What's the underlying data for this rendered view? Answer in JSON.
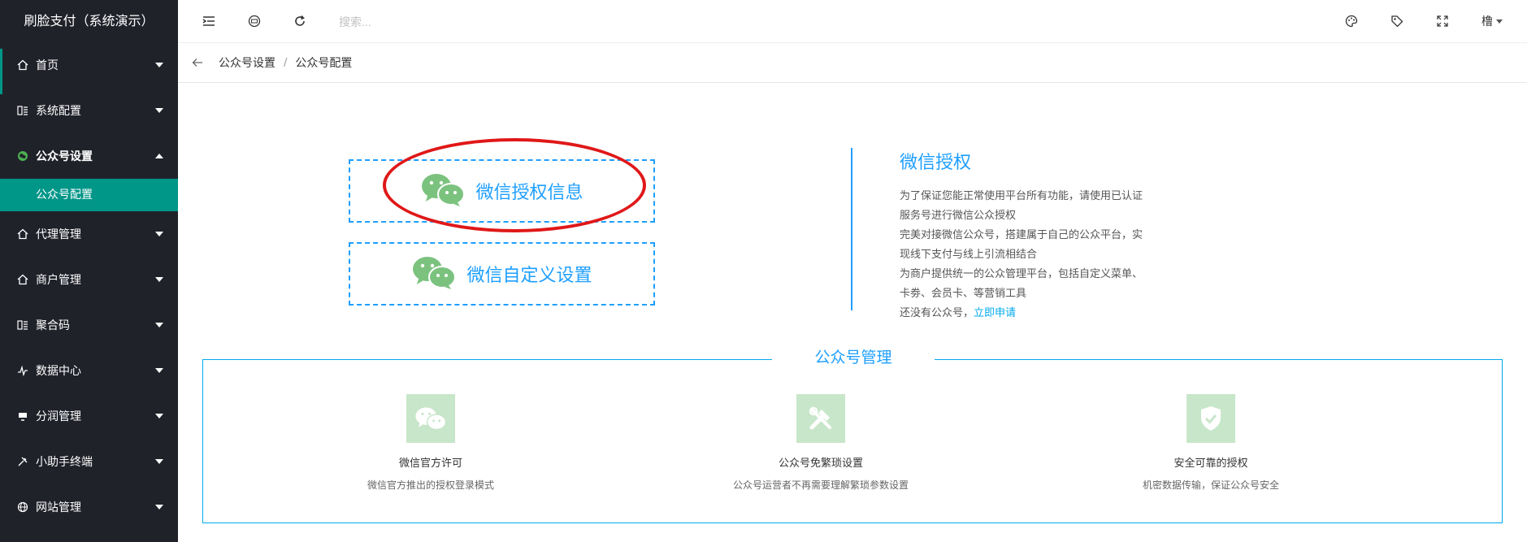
{
  "app": {
    "title": "刷脸支付（系统演示）"
  },
  "sidebar": {
    "items": [
      {
        "label": "首页",
        "icon": "home-icon",
        "expanded": false
      },
      {
        "label": "系统配置",
        "icon": "settings-list-icon",
        "expanded": false
      },
      {
        "label": "公众号设置",
        "icon": "wechat-icon",
        "expanded": true,
        "active": true
      },
      {
        "label": "代理管理",
        "icon": "home-icon",
        "expanded": false
      },
      {
        "label": "商户管理",
        "icon": "home-icon",
        "expanded": false
      },
      {
        "label": "聚合码",
        "icon": "settings-list-icon",
        "expanded": false
      },
      {
        "label": "数据中心",
        "icon": "chart-icon",
        "expanded": false
      },
      {
        "label": "分润管理",
        "icon": "monitor-icon",
        "expanded": false
      },
      {
        "label": "小助手终端",
        "icon": "tool-icon",
        "expanded": false
      },
      {
        "label": "网站管理",
        "icon": "globe-icon",
        "expanded": false
      }
    ],
    "subitem": {
      "label": "公众号配置",
      "active": true
    }
  },
  "header": {
    "search_placeholder": "搜索...",
    "user_name": "橹"
  },
  "breadcrumb": {
    "items": [
      "公众号设置",
      "公众号配置"
    ],
    "separator": "/"
  },
  "main": {
    "cards": [
      {
        "label": "微信授权信息",
        "highlighted": true
      },
      {
        "label": "微信自定义设置"
      }
    ],
    "auth": {
      "title": "微信授权",
      "paragraphs": [
        "为了保证您能正常使用平台所有功能，请使用已认证服务号进行微信公众授权",
        "完美对接微信公众号，搭建属于自己的公众平台，实现线下支付与线上引流相结合",
        "为商户提供统一的公众管理平台，包括自定义菜单、卡劵、会员卡、等营销工具"
      ],
      "no_account_text": "还没有公众号，",
      "apply_link": "立即申请"
    },
    "management": {
      "title": "公众号管理",
      "features": [
        {
          "icon": "wechat-icon",
          "name": "微信官方许可",
          "desc": "微信官方推出的授权登录模式"
        },
        {
          "icon": "tools-icon",
          "name": "公众号免繁琐设置",
          "desc": "公众号运营者不再需要理解繁琐参数设置"
        },
        {
          "icon": "shield-check-icon",
          "name": "安全可靠的授权",
          "desc": "机密数据传输，保证公众号安全"
        }
      ]
    }
  },
  "colors": {
    "sidebar_bg": "#20222a",
    "accent": "#009688",
    "blue": "#1e9fff",
    "link": "#01aaed",
    "annotation_red": "#e01818",
    "icon_green": "#7cc27f",
    "icon_tile": "#c8e6c9"
  }
}
